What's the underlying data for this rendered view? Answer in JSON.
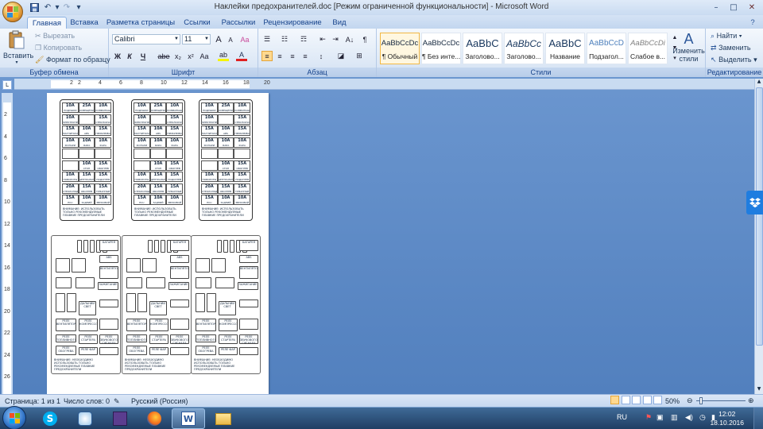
{
  "window": {
    "title": "Наклейки предохранителей.doc [Режим ограниченной функциональности] - Microsoft Word",
    "minimize": "–",
    "maximize": "□",
    "close": "✕"
  },
  "qat": {
    "save": "save-icon",
    "undo": "↶",
    "redo": "↷",
    "customize": "▾"
  },
  "tabs": [
    "Главная",
    "Вставка",
    "Разметка страницы",
    "Ссылки",
    "Рассылки",
    "Рецензирование",
    "Вид"
  ],
  "clipboard": {
    "paste": "Вставить",
    "cut": "Вырезать",
    "copy": "Копировать",
    "format_painter": "Формат по образцу",
    "group": "Буфер обмена"
  },
  "font": {
    "name": "Calibri",
    "size": "11",
    "grow": "A",
    "shrink": "A",
    "clear": "Aa",
    "bold": "Ж",
    "italic": "К",
    "underline": "Ч",
    "strike": "abe",
    "subscript": "x₂",
    "superscript": "x²",
    "case": "Aa",
    "highlight": "ab",
    "color": "A",
    "group": "Шрифт"
  },
  "paragraph": {
    "sort": "A↓",
    "show_marks": "¶",
    "group": "Абзац"
  },
  "styles": {
    "items": [
      {
        "preview": "AaBbCcDc",
        "name": "¶ Обычный"
      },
      {
        "preview": "AaBbCcDc",
        "name": "¶ Без инте..."
      },
      {
        "preview": "AaBbC",
        "name": "Заголово..."
      },
      {
        "preview": "AaBbCc",
        "name": "Заголово..."
      },
      {
        "preview": "AaBbC",
        "name": "Название"
      },
      {
        "preview": "AaBbCcD",
        "name": "Подзагол..."
      },
      {
        "preview": "AaBbCcDi",
        "name": "Слабое в..."
      }
    ],
    "change": "Изменить",
    "change2": "стили",
    "group": "Стили"
  },
  "editing": {
    "find": "Найти",
    "replace": "Заменить",
    "select": "Выделить",
    "group": "Редактирование"
  },
  "ruler": {
    "h": [
      "2",
      "2",
      "4",
      "6",
      "8",
      "10",
      "12",
      "14",
      "16",
      "18",
      "20"
    ],
    "v": [
      "2",
      "4",
      "6",
      "8",
      "10",
      "12",
      "14",
      "16",
      "18",
      "20",
      "22",
      "24",
      "26"
    ]
  },
  "fuse_cards": [
    {
      "rows": [
        [
          {
            "a": "10A",
            "t": "ПОДУШКИ БЕЗОПАСНОСТИ"
          },
          {
            "a": "25A",
            "t": "ОСВЕЩЕНИЕ САЛОНА"
          },
          {
            "a": "10A",
            "t": "КОМБИНАЦИЯ ПРИБОРОВ"
          }
        ],
        [
          {
            "a": "10A",
            "t": "ЭЛЕКТРОПРИВОД ЗЕРКАЛ"
          },
          {
            "a": "",
            "t": ""
          },
          {
            "a": "15A",
            "t": "СТЕКЛООЧИСТИТЕЛЬ"
          }
        ],
        [
          {
            "a": "15A",
            "t": "МАГНИТОЛА"
          },
          {
            "a": "10A",
            "t": "ABS"
          },
          {
            "a": "15A",
            "t": "ПРИКУРИВАТЕЛЬ"
          }
        ],
        [
          {
            "a": "10A",
            "t": "ФОНАРИ ЗАДНИЕ"
          },
          {
            "a": "10A",
            "t": "ФАРА ЛЕВАЯ"
          },
          {
            "a": "10A",
            "t": "ФАРА ПРАВАЯ"
          }
        ],
        [
          {
            "a": "",
            "t": ""
          },
          {
            "a": "",
            "t": ""
          },
          {
            "a": "",
            "t": ""
          }
        ],
        [
          {
            "a": "",
            "t": ""
          },
          {
            "a": "10A",
            "t": "СТОП"
          },
          {
            "a": "15A",
            "t": "ОБОГРЕВ СТЕКЛА"
          }
        ],
        [
          {
            "a": "10A",
            "t": "ПОВОРОТЫ"
          },
          {
            "a": "15A",
            "t": "ЦЕНТРАЛЬНЫЙ ЗАМОК"
          },
          {
            "a": "15A",
            "t": "ПОДОГРЕВ СИДЕНИЙ"
          }
        ],
        [
          {
            "a": "20A",
            "t": "СТЕКЛОПОДЪЕМНИКИ"
          },
          {
            "a": "15A",
            "t": "ОБОГРЕВ ЗЕРКАЛ"
          },
          {
            "a": "15A",
            "t": "ТУМАННЫЕ ФАРЫ"
          }
        ],
        [
          {
            "a": "15A",
            "t": "ECU"
          },
          {
            "a": "10A",
            "t": "ЗАДНИЙ ХОД"
          },
          {
            "a": "10A",
            "t": "ЗВУКОВОЙ СИГНАЛ"
          }
        ]
      ],
      "note": "ВНИМАНИЕ: ИСПОЛЬЗОВАТЬ ТОЛЬКО РЕКОМЕНДУЕМЫЕ ПЛАВКИЕ ПРЕДОХРАНИТЕЛИ"
    }
  ],
  "fuse_box": {
    "labels": [
      "БАТАРЕЯ",
      "ABS",
      "ВЕНТИЛЯТОР",
      "ЗАЖИГАНИЕ",
      "ДАЛЬНИЙ СВЕТ",
      "РЕЛЕ ВЕНТИЛЯТОРА",
      "РЕЛЕ КОМПРЕССОРА",
      "РЕЛЕ ТОПЛИВНОГО НАСОСА",
      "РЕЛЕ СТАРТЕРА",
      "РЕЛЕ ЗВУКОВОГО СИГНАЛА",
      "РЕЛЕ ОБОГРЕВА",
      "РЕЛЕ ФАР"
    ],
    "note": "ВНИМАНИЕ: НЕОБХОДИМО ИСПОЛЬЗОВАТЬ ТОЛЬКО РЕКОМЕНДУЕМЫЕ ПЛАВКИЕ ПРЕДОХРАНИТЕЛИ"
  },
  "status": {
    "page": "Страница: 1 из 1",
    "words": "Число слов: 0",
    "lang": "Русский (Россия)",
    "zoom": "50%"
  },
  "taskbar": {
    "lang": "RU",
    "time": "12:02",
    "date": "18.10.2016"
  },
  "colors": {
    "accent": "#15428b",
    "workspace": "#5f8bc7",
    "word_blue": "#2b579a"
  }
}
